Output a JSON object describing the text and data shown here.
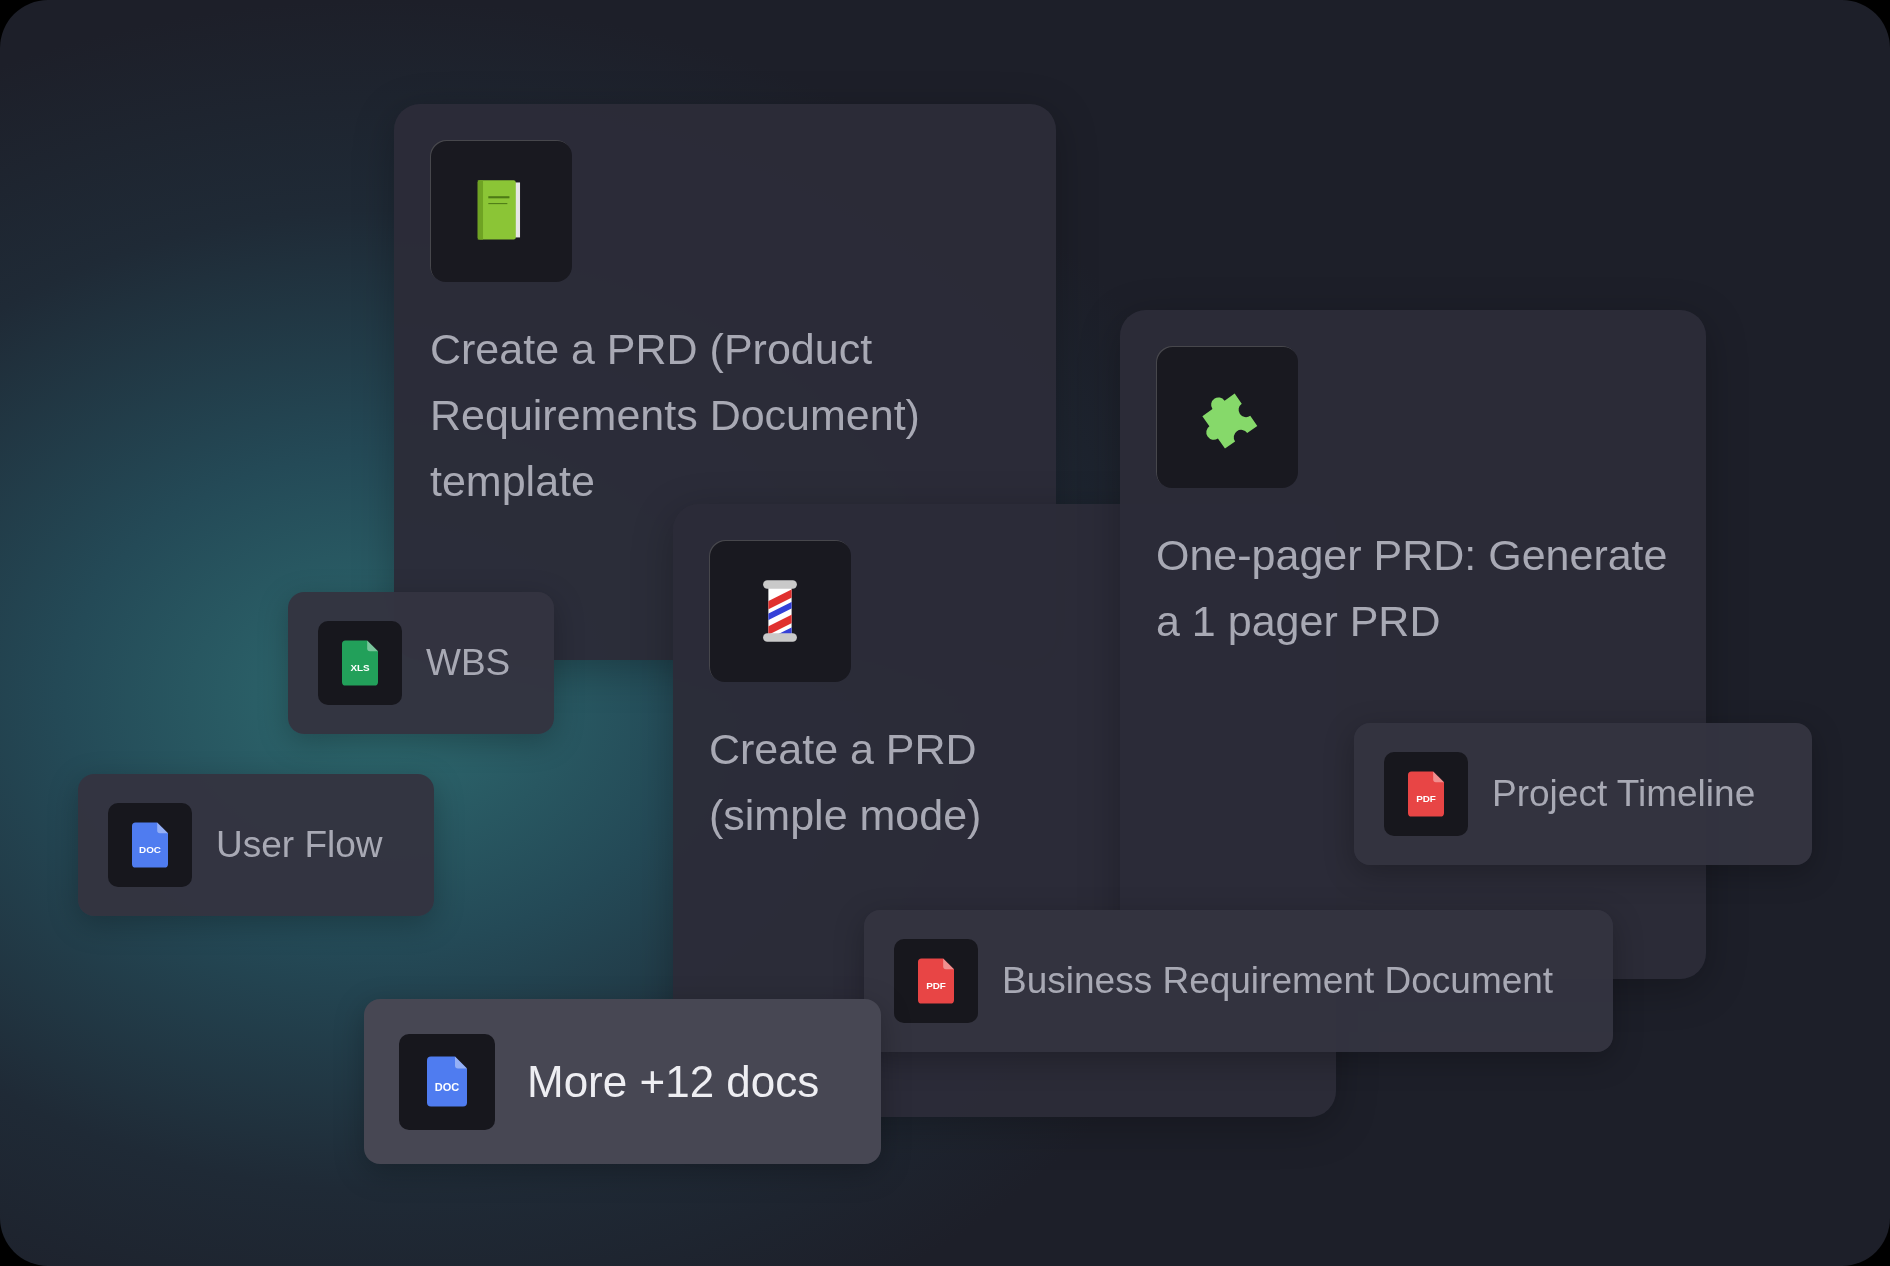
{
  "task_cards": [
    {
      "kind": "book",
      "title": "Create a PRD (Product Requirements Document) template"
    },
    {
      "kind": "barber-pole",
      "title": "Create a PRD (simple mode)"
    },
    {
      "kind": "puzzle",
      "title": "One-pager PRD: Generate a 1 pager PRD"
    }
  ],
  "doc_chips": [
    {
      "name": "WBS",
      "file_type": "XLS",
      "color": "#22a05a"
    },
    {
      "name": "User Flow",
      "file_type": "DOC",
      "color": "#4f7cf0"
    },
    {
      "name": "Project Timeline",
      "file_type": "PDF",
      "color": "#e84545"
    },
    {
      "name": "Business Requirement Document",
      "file_type": "PDF",
      "color": "#e84545"
    }
  ],
  "more_chip": {
    "name": "More +12 docs",
    "file_type": "DOC",
    "color": "#4f7cf0"
  }
}
